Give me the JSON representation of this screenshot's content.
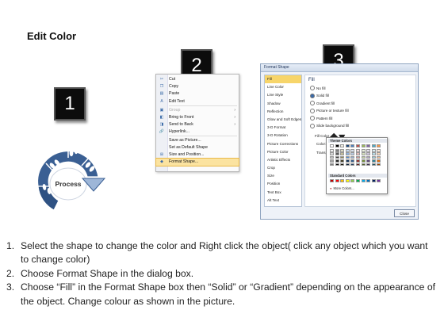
{
  "page_title": "Edit Color",
  "badges": [
    "1",
    "2",
    "3"
  ],
  "process_label": "Process",
  "colors": {
    "shape_blue": "#3a5f93",
    "badge_black": "#0c0c0c",
    "menu_highlight": "#fbe3a0",
    "dialog_selected": "#f7d56a"
  },
  "context_menu": {
    "items": [
      {
        "label": "Cut",
        "icon": "scissors-icon",
        "state": "normal"
      },
      {
        "label": "Copy",
        "icon": "copy-icon",
        "state": "normal"
      },
      {
        "label": "Paste",
        "icon": "paste-icon",
        "state": "normal"
      },
      {
        "label": "Edit Text",
        "icon": "edit-text-icon",
        "state": "normal"
      },
      {
        "label": "Group",
        "icon": "group-icon",
        "state": "disabled",
        "submenu": true
      },
      {
        "label": "Bring to Front",
        "icon": "bring-front-icon",
        "state": "normal",
        "submenu": true
      },
      {
        "label": "Send to Back",
        "icon": "send-back-icon",
        "state": "normal",
        "submenu": true
      },
      {
        "label": "Hyperlink...",
        "icon": "hyperlink-icon",
        "state": "normal"
      },
      {
        "label": "Save as Picture...",
        "icon": "",
        "state": "normal"
      },
      {
        "label": "Set as Default Shape",
        "icon": "",
        "state": "normal"
      },
      {
        "label": "Size and Position...",
        "icon": "size-position-icon",
        "state": "normal"
      },
      {
        "label": "Format Shape...",
        "icon": "format-shape-icon",
        "state": "highlighted"
      }
    ]
  },
  "format_dialog": {
    "title": "Format Shape",
    "sidebar": [
      "Fill",
      "Line Color",
      "Line Style",
      "Shadow",
      "Reflection",
      "Glow and Soft Edges",
      "3-D Format",
      "3-D Rotation",
      "Picture Corrections",
      "Picture Color",
      "Artistic Effects",
      "Crop",
      "Size",
      "Position",
      "Text Box",
      "Alt Text"
    ],
    "selected": "Fill",
    "heading": "Fill",
    "options": [
      "No fill",
      "Solid fill",
      "Gradient fill",
      "Picture or texture fill",
      "Pattern fill",
      "Slide background fill"
    ],
    "selected_option": "Solid fill",
    "fill_color_label": "Fill Color",
    "color_label": "Color:",
    "transparency_label": "Transpa",
    "close_label": "Close"
  },
  "palette": {
    "theme_label": "Theme Colors",
    "standard_label": "Standard Colors",
    "more_label": "More Colors...",
    "theme_top": [
      "#ffffff",
      "#000000",
      "#eeece1",
      "#1f497d",
      "#4f81bd",
      "#c0504d",
      "#9bbb59",
      "#8064a2",
      "#4bacc6",
      "#f79646"
    ],
    "theme_shades": [
      [
        "#f2f2f2",
        "#7f7f7f",
        "#ddd9c3",
        "#c6d9f0",
        "#dbe5f1",
        "#f2dcdb",
        "#ebf1dd",
        "#e5e0ec",
        "#dbeef3",
        "#fdeada"
      ],
      [
        "#d8d8d8",
        "#595959",
        "#c4bd97",
        "#8db3e2",
        "#b8cce4",
        "#e5b9b7",
        "#d7e3bc",
        "#ccc1d9",
        "#b7dde8",
        "#fbd5b5"
      ],
      [
        "#bfbfbf",
        "#3f3f3f",
        "#938953",
        "#548dd4",
        "#95b3d7",
        "#d99694",
        "#c3d69b",
        "#b2a2c7",
        "#92cddc",
        "#fac08f"
      ],
      [
        "#a5a5a5",
        "#262626",
        "#494429",
        "#17365d",
        "#366092",
        "#953734",
        "#76923c",
        "#5f497a",
        "#31859b",
        "#e36c09"
      ],
      [
        "#7f7f7f",
        "#0c0c0c",
        "#1d1b10",
        "#0f243e",
        "#244061",
        "#632423",
        "#4f6128",
        "#3f3151",
        "#205867",
        "#974806"
      ]
    ],
    "standard": [
      "#c00000",
      "#ff0000",
      "#ffc000",
      "#ffff00",
      "#92d050",
      "#00b050",
      "#00b0f0",
      "#0070c0",
      "#002060",
      "#7030a0"
    ]
  },
  "instructions": [
    {
      "num": "1.",
      "text": "Select the shape to change the color and Right click the object( click any object which you want to change color)"
    },
    {
      "num": "2.",
      "text": "Choose Format Shape in the dialog box."
    },
    {
      "num": "3.",
      "text": "Choose “Fill” in the Format Shape box then “Solid” or “Gradient” depending on the appearance of the object. Change colour as shown in the picture."
    }
  ]
}
